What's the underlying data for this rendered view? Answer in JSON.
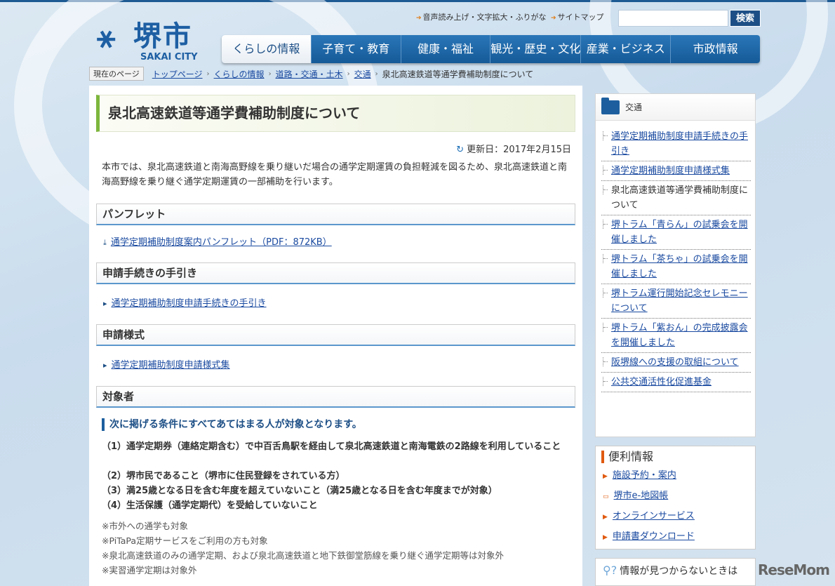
{
  "header": {
    "logo_text": "堺市",
    "logo_en": "SAKAI CITY",
    "util_links": [
      "音声読み上げ・文字拡大・ふりがな",
      "サイトマップ"
    ],
    "search_placeholder": "",
    "search_button": "検索"
  },
  "nav": [
    "くらしの情報",
    "子育て・教育",
    "健康・福祉",
    "観光・歴史・文化",
    "産業・ビジネス",
    "市政情報"
  ],
  "breadcrumb": {
    "label": "現在のページ",
    "items": [
      "トップページ",
      "くらしの情報",
      "道路・交通・土木",
      "交通"
    ],
    "current": "泉北高速鉄道等通学費補助制度について"
  },
  "main": {
    "title": "泉北高速鉄道等通学費補助制度について",
    "updated": "更新日：2017年2月15日",
    "intro": "本市では、泉北高速鉄道と南海高野線を乗り継いだ場合の通学定期運賃の負担軽減を図るため、泉北高速鉄道と南海高野線を乗り継ぐ通学定期運賃の一部補助を行います。",
    "sections": [
      {
        "heading": "パンフレット",
        "link": "通学定期補助制度案内パンフレット（PDF：872KB）"
      },
      {
        "heading": "申請手続きの手引き",
        "link": "通学定期補助制度申請手続きの手引き"
      },
      {
        "heading": "申請様式",
        "link": "通学定期補助制度申請様式集"
      },
      {
        "heading": "対象者"
      }
    ],
    "target_sub": "次に掲げる条件にすべてあてはまる人が対象となります。",
    "conditions": [
      "（1）通学定期券（連絡定期含む）で中百舌鳥駅を経由して泉北高速鉄道と南海電鉄の2路線を利用していること",
      "（2）堺市民であること（堺市に住民登録をされている方）",
      "（3）満25歳となる日を含む年度を超えていないこと（満25歳となる日を含む年度までが対象）",
      "（4）生活保護（通学定期代）を受給していないこと"
    ],
    "notes": [
      "※市外への通学も対象",
      "※PiTaPa定期サービスをご利用の方も対象",
      "※泉北高速鉄道のみの通学定期、および泉北高速鉄道と地下鉄御堂筋線を乗り継ぐ通学定期等は対象外",
      "※実習通学定期は対象外"
    ]
  },
  "sidebar": {
    "category": "交通",
    "items": [
      "通学定期補助制度申請手続きの手引き",
      "通学定期補助制度申請様式集",
      "泉北高速鉄道等通学費補助制度について",
      "堺トラム「青らん」の試乗会を開催しました",
      "堺トラム「茶ちゃ」の試乗会を開催しました",
      "堺トラム運行開始記念セレモニーについて",
      "堺トラム「紫おん」の完成披露会を開催しました",
      "阪堺線への支援の取組について",
      "公共交通活性化促進基金"
    ],
    "useful_title": "便利情報",
    "useful": [
      "施設予約・案内",
      "堺市e-地図帳",
      "オンラインサービス",
      "申請書ダウンロード"
    ],
    "notfound": "情報が見つからないときは"
  },
  "watermark": "ReseMom"
}
